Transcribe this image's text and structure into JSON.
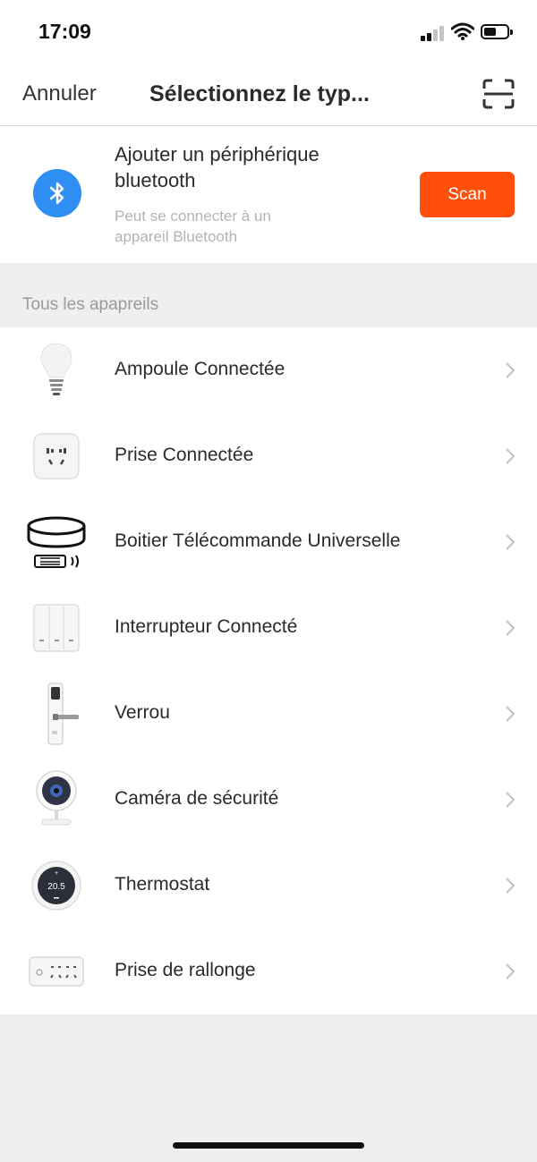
{
  "status_bar": {
    "time": "17:09"
  },
  "nav": {
    "cancel_label": "Annuler",
    "title": "Sélectionnez le typ...",
    "scan_icon": "scan-frame-icon"
  },
  "bluetooth": {
    "title": "Ajouter un périphérique bluetooth",
    "subtitle": "Peut se connecter à un appareil Bluetooth",
    "scan_label": "Scan",
    "icon": "bluetooth-icon",
    "accent": "#ff4f0b",
    "icon_bg": "#2f8ff3"
  },
  "section": {
    "label": "Tous les apapreils"
  },
  "devices": [
    {
      "label": "Ampoule Connectée",
      "icon": "bulb-icon"
    },
    {
      "label": "Prise Connectée",
      "icon": "plug-icon"
    },
    {
      "label": "Boitier Télécommande Universelle",
      "icon": "ir-remote-hub-icon"
    },
    {
      "label": "Interrupteur Connecté",
      "icon": "wall-switch-icon"
    },
    {
      "label": "Verrou",
      "icon": "door-lock-icon"
    },
    {
      "label": "Caméra de sécurité",
      "icon": "security-camera-icon"
    },
    {
      "label": "Thermostat",
      "icon": "thermostat-icon",
      "display_value": "20.5"
    },
    {
      "label": "Prise de rallonge",
      "icon": "power-strip-icon"
    }
  ]
}
